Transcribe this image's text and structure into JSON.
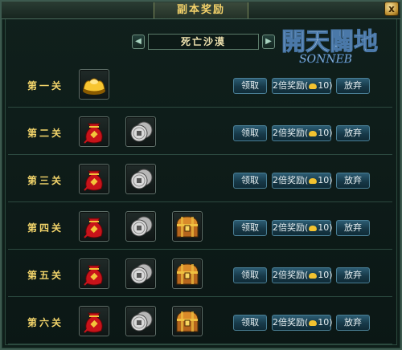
{
  "window": {
    "title": "副本奖励",
    "close_label": "x"
  },
  "logo": {
    "text_cn": "開天闢地",
    "text_en": "SONNEB"
  },
  "dungeon": {
    "name": "死亡沙漠",
    "prev_icon": "arrow-left-icon",
    "next_icon": "arrow-right-icon"
  },
  "buttons": {
    "claim": "领取",
    "double_prefix": "2倍奖励(",
    "double_suffix": "10)",
    "abandon": "放弃"
  },
  "rows": [
    {
      "label": "第一关",
      "rewards": [
        "gold-ingot-icon"
      ]
    },
    {
      "label": "第二关",
      "rewards": [
        "red-pouch-icon",
        "silver-coin-icon"
      ]
    },
    {
      "label": "第三关",
      "rewards": [
        "red-pouch-icon",
        "silver-coin-icon"
      ]
    },
    {
      "label": "第四关",
      "rewards": [
        "red-pouch-icon",
        "silver-coin-icon",
        "treasure-chest-icon"
      ]
    },
    {
      "label": "第五关",
      "rewards": [
        "red-pouch-icon",
        "silver-coin-icon",
        "treasure-chest-icon"
      ]
    },
    {
      "label": "第六关",
      "rewards": [
        "red-pouch-icon",
        "silver-coin-icon",
        "treasure-chest-icon"
      ]
    }
  ],
  "colors": {
    "title_gold": "#f4d26a",
    "button_blue": "#2c5c73",
    "frame_green": "#3d5a4f"
  }
}
